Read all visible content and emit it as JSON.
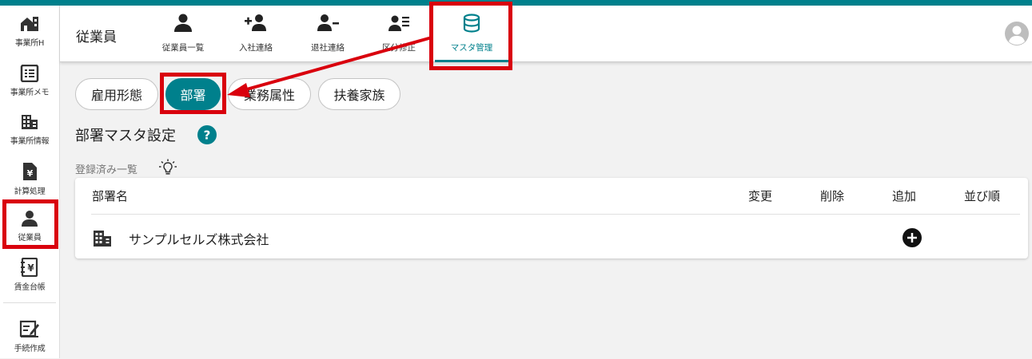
{
  "colors": {
    "accent": "#00808c",
    "annotation": "#d9000d"
  },
  "sidebar": {
    "items": [
      {
        "label": "事業所H",
        "icon": "office-home-icon"
      },
      {
        "label": "事業所メモ",
        "icon": "list-icon"
      },
      {
        "label": "事業所情報",
        "icon": "building-icon"
      },
      {
        "label": "計算処理",
        "icon": "yen-document-icon"
      },
      {
        "label": "従業員",
        "icon": "person-icon"
      },
      {
        "label": "賃金台帳",
        "icon": "yen-book-icon"
      },
      {
        "label": "手続作成",
        "icon": "edit-document-icon"
      }
    ]
  },
  "header": {
    "title": "従業員",
    "tabs": [
      {
        "label": "従業員一覧",
        "icon": "person-icon"
      },
      {
        "label": "入社連絡",
        "icon": "person-add-icon"
      },
      {
        "label": "退社連絡",
        "icon": "person-remove-icon"
      },
      {
        "label": "区分修正",
        "icon": "person-list-icon"
      },
      {
        "label": "マスタ管理",
        "icon": "database-icon",
        "active": true
      }
    ]
  },
  "chips": [
    {
      "label": "雇用形態"
    },
    {
      "label": "部署",
      "active": true
    },
    {
      "label": "業務属性"
    },
    {
      "label": "扶養家族"
    }
  ],
  "section": {
    "title": "部署マスタ設定",
    "registered_label": "登録済み一覧"
  },
  "table": {
    "columns": [
      "部署名",
      "変更",
      "削除",
      "追加",
      "並び順"
    ],
    "rows": [
      {
        "name": "サンプルセルズ株式会社"
      }
    ]
  }
}
